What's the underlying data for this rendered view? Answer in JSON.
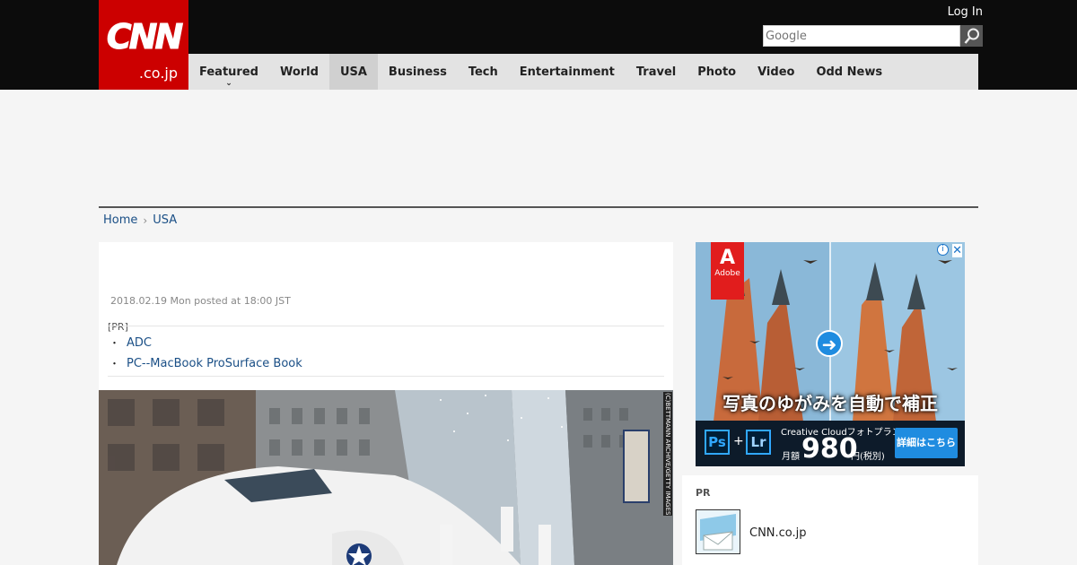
{
  "header": {
    "logo_main": "CNN",
    "logo_sub": ".co.jp",
    "login_label": "Log In",
    "search_placeholder": "Google"
  },
  "nav": {
    "items": [
      {
        "label": "Featured"
      },
      {
        "label": "World"
      },
      {
        "label": "USA"
      },
      {
        "label": "Business"
      },
      {
        "label": "Tech"
      },
      {
        "label": "Entertainment"
      },
      {
        "label": "Travel"
      },
      {
        "label": "Photo"
      },
      {
        "label": "Video"
      },
      {
        "label": "Odd News"
      }
    ],
    "active": "USA"
  },
  "breadcrumb": {
    "home": "Home",
    "current": "USA"
  },
  "article": {
    "posted": "2018.02.19 Mon posted at 18:00 JST",
    "pr_label": "[PR]",
    "pr_links": [
      "ADC",
      "PC--MacBook ProSurface Book"
    ],
    "photo_credit": "(C)BETTMANN ARCHIVE/GETTY IMAGES"
  },
  "ad": {
    "brand": "Adobe",
    "headline": "写真のゆがみを自動で補正",
    "product": "Creative Cloudフォトプラン",
    "price_prefix": "月額",
    "price": "980",
    "price_suffix": "円(税別)",
    "cta": "詳細はこちら",
    "ps": "Ps",
    "plus": "+",
    "lr": "Lr",
    "info": "i",
    "close": "✕"
  },
  "sidebar_pr": {
    "label": "PR",
    "name": "CNN.co.jp"
  },
  "colors": {
    "brand_red": "#cc0000",
    "link_blue": "#1a4f86",
    "topbar": "#0c0c0c",
    "nav_bg": "#e3e3e3"
  }
}
